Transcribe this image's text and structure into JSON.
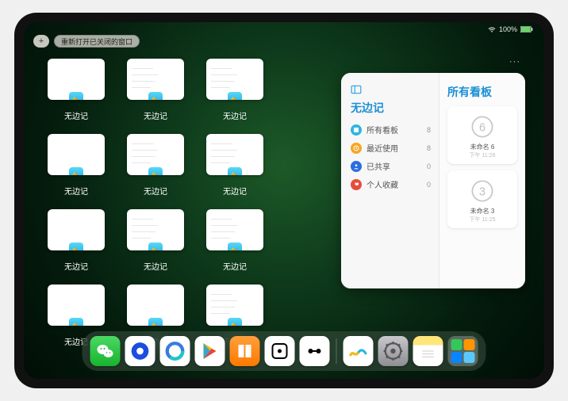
{
  "status": {
    "battery": "100%",
    "signal": "wifi"
  },
  "top": {
    "plus": "+",
    "reopen": "重新打开已关闭的窗口"
  },
  "thumb_label": "无边记",
  "thumbs": [
    {
      "lines": false
    },
    {
      "lines": true
    },
    {
      "lines": true
    },
    {
      "lines": false
    },
    {
      "lines": true
    },
    {
      "lines": true
    },
    {
      "lines": false
    },
    {
      "lines": true
    },
    {
      "lines": true
    },
    {
      "lines": false
    },
    {
      "lines": false
    },
    {
      "lines": true
    }
  ],
  "panel": {
    "more": "···",
    "title_left": "无边记",
    "title_right": "所有看板",
    "sidebar": [
      {
        "label": "所有看板",
        "count": "8",
        "color": "#2fb6e0"
      },
      {
        "label": "最近使用",
        "count": "8",
        "color": "#f5a623"
      },
      {
        "label": "已共享",
        "count": "0",
        "color": "#2b6ee0"
      },
      {
        "label": "个人收藏",
        "count": "0",
        "color": "#e74c3c"
      }
    ],
    "boards": [
      {
        "label": "未命名 6",
        "time": "下午 11:26",
        "digit": "6"
      },
      {
        "label": "未命名 3",
        "time": "下午 11:25",
        "digit": "3"
      }
    ]
  },
  "dock": [
    {
      "name": "wechat",
      "bg": "linear-gradient(180deg,#4bd864,#17b42e)"
    },
    {
      "name": "qqbrowser",
      "bg": "#fff"
    },
    {
      "name": "quark",
      "bg": "#fff"
    },
    {
      "name": "play",
      "bg": "#fff"
    },
    {
      "name": "books",
      "bg": "linear-gradient(180deg,#ff9f3b,#ff7a00)"
    },
    {
      "name": "dice",
      "bg": "#fff"
    },
    {
      "name": "connect",
      "bg": "#fff"
    },
    {
      "name": "freeform",
      "bg": "#fff"
    },
    {
      "name": "settings",
      "bg": "linear-gradient(180deg,#c7c7cc,#8e8e93)"
    },
    {
      "name": "notes",
      "bg": "linear-gradient(180deg,#ffe67a 0 30%,#fff 30%)"
    }
  ]
}
